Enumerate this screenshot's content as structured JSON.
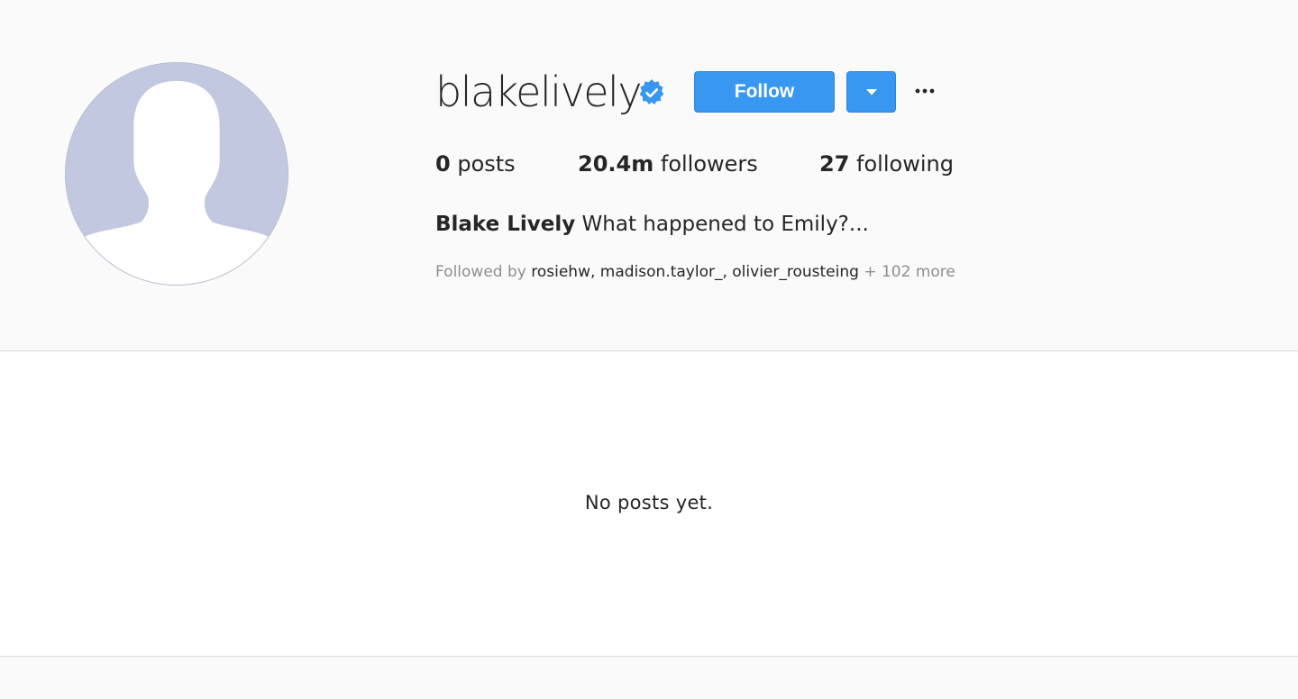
{
  "profile": {
    "username": "blakelively",
    "verified_icon": "verified-badge-icon",
    "follow_label": "Follow",
    "dropdown_icon": "caret-down-icon",
    "more_label": "···",
    "stats": {
      "posts_count": "0",
      "posts_label": "posts",
      "followers_count": "20.4m",
      "followers_label": "followers",
      "following_count": "27",
      "following_label": "following"
    },
    "bio": {
      "full_name": "Blake Lively",
      "text": "What happened to Emily?..."
    },
    "followed_by": {
      "prefix": "Followed by",
      "names": "rosiehw, madison.taylor_, olivier_rousteing",
      "suffix": "+ 102 more"
    }
  },
  "posts": {
    "empty_message": "No posts yet."
  },
  "colors": {
    "accent": "#3897f0",
    "verified": "#3897f0",
    "avatar_bg": "#c2c8df",
    "text": "#262626",
    "muted": "#8e8e8e"
  }
}
